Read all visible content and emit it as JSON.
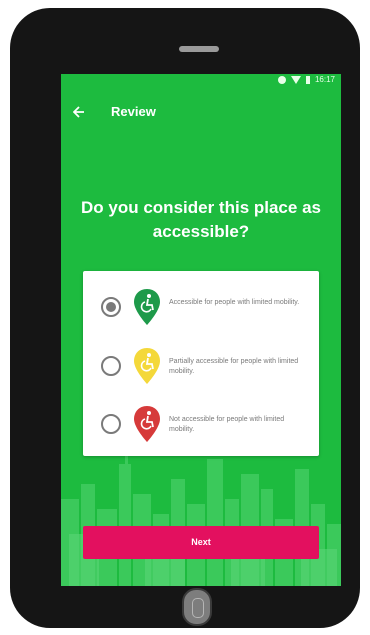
{
  "status_bar": {
    "time": "16:17"
  },
  "app_bar": {
    "title": "Review",
    "back_icon": "arrow-left-icon"
  },
  "question": "Do you consider this place as accessible?",
  "options": [
    {
      "label": "Accessible for people with limited mobility.",
      "selected": true,
      "color": "#1e9a4a",
      "icon": "wheelchair-marker-icon"
    },
    {
      "label": "Partially accessible for people with limited mobility.",
      "selected": false,
      "color": "#f4d83a",
      "icon": "wheelchair-marker-icon"
    },
    {
      "label": "Not accessible for people with limited mobility.",
      "selected": false,
      "color": "#d63a3a",
      "icon": "wheelchair-marker-icon"
    }
  ],
  "next_button": {
    "label": "Next"
  },
  "colors": {
    "primary": "#1dbb3f",
    "accent": "#e3105f",
    "card": "#ffffff"
  }
}
